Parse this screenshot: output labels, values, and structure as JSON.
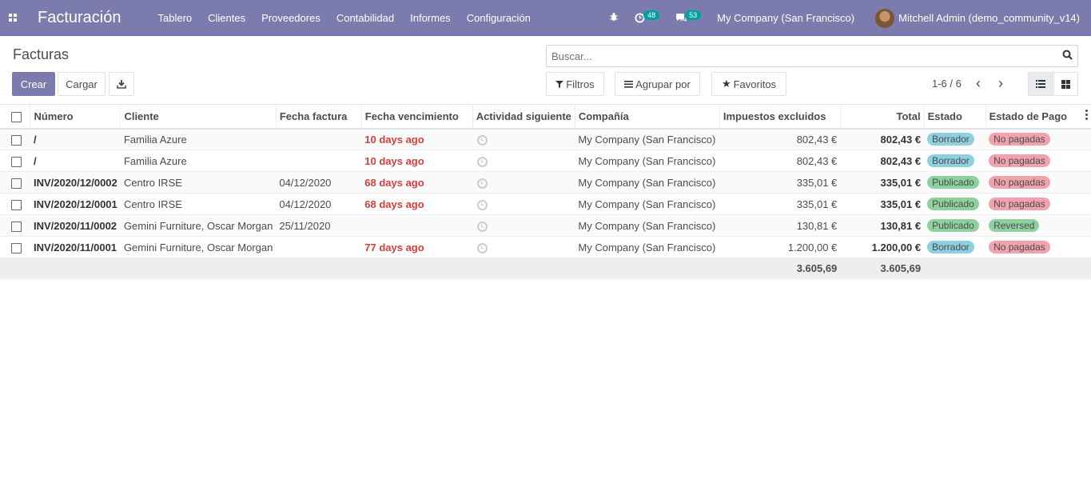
{
  "navbar": {
    "app_title": "Facturación",
    "menu": [
      "Tablero",
      "Clientes",
      "Proveedores",
      "Contabilidad",
      "Informes",
      "Configuración"
    ],
    "activity_count": "48",
    "messages_count": "53",
    "company": "My Company (San Francisco)",
    "user": "Mitchell Admin (demo_community_v14)"
  },
  "control": {
    "breadcrumb": "Facturas",
    "create_label": "Crear",
    "upload_label": "Cargar",
    "search_placeholder": "Buscar...",
    "filters_label": "Filtros",
    "groupby_label": "Agrupar por",
    "favorites_label": "Favoritos",
    "pager": "1-6 / 6"
  },
  "table": {
    "headers": [
      "Número",
      "Cliente",
      "Fecha factura",
      "Fecha vencimiento",
      "Actividad siguiente",
      "Compañía",
      "Impuestos excluidos",
      "Total",
      "Estado",
      "Estado de Pago"
    ],
    "rows": [
      {
        "number": "/",
        "client": "Familia Azure",
        "invoice_date": "",
        "due": "10 days ago",
        "company": "My Company (San Francisco)",
        "untaxed": "802,43 €",
        "total": "802,43 €",
        "state": "Borrador",
        "payment": "No pagadas"
      },
      {
        "number": "/",
        "client": "Familia Azure",
        "invoice_date": "",
        "due": "10 days ago",
        "company": "My Company (San Francisco)",
        "untaxed": "802,43 €",
        "total": "802,43 €",
        "state": "Borrador",
        "payment": "No pagadas"
      },
      {
        "number": "INV/2020/12/0002",
        "client": "Centro IRSE",
        "invoice_date": "04/12/2020",
        "due": "68 days ago",
        "company": "My Company (San Francisco)",
        "untaxed": "335,01 €",
        "total": "335,01 €",
        "state": "Publicado",
        "payment": "No pagadas"
      },
      {
        "number": "INV/2020/12/0001",
        "client": "Centro IRSE",
        "invoice_date": "04/12/2020",
        "due": "68 days ago",
        "company": "My Company (San Francisco)",
        "untaxed": "335,01 €",
        "total": "335,01 €",
        "state": "Publicado",
        "payment": "No pagadas"
      },
      {
        "number": "INV/2020/11/0002",
        "client": "Gemini Furniture, Oscar Morgan",
        "invoice_date": "25/11/2020",
        "due": "",
        "company": "My Company (San Francisco)",
        "untaxed": "130,81 €",
        "total": "130,81 €",
        "state": "Publicado",
        "payment": "Reversed"
      },
      {
        "number": "INV/2020/11/0001",
        "client": "Gemini Furniture, Oscar Morgan",
        "invoice_date": "",
        "due": "77 days ago",
        "company": "My Company (San Francisco)",
        "untaxed": "1.200,00 €",
        "total": "1.200,00 €",
        "state": "Borrador",
        "payment": "No pagadas"
      }
    ],
    "footer_untaxed": "3.605,69",
    "footer_total": "3.605,69"
  },
  "colors": {
    "brand": "#7c7bad",
    "draft": "#8ed0df",
    "posted": "#8fd19e",
    "unpaid": "#f0a3ad",
    "reversed": "#8fd19e"
  }
}
